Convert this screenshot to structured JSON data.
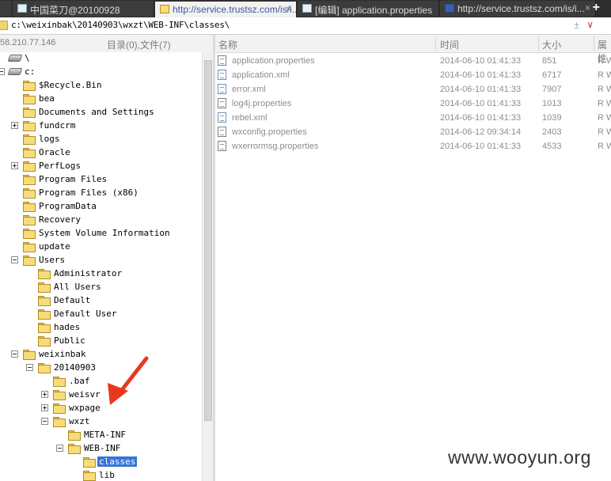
{
  "tabs": [
    {
      "label": "中国菜刀@20100928"
    },
    {
      "label": "http://service.trustsz.com/is/i..."
    },
    {
      "label": "[编辑] application.properties"
    },
    {
      "label": "http://service.trustsz.com/is/i..."
    }
  ],
  "tab_close_glyph": "×",
  "new_tab_glyph": "+",
  "path": {
    "value": "c:\\weixinbak\\20140903\\wxzt\\WEB-INF\\classes\\",
    "up_glyph": "±",
    "dropdown_glyph": "∨"
  },
  "tree_header": {
    "ip": "58.210.77.146",
    "count": "目录(0),文件(7)"
  },
  "tree": [
    {
      "label": "\\",
      "type": "drive"
    },
    {
      "label": "c:",
      "type": "drive"
    },
    {
      "label": "$Recycle.Bin"
    },
    {
      "label": "bea"
    },
    {
      "label": "Documents and Settings"
    },
    {
      "label": "fundcrm"
    },
    {
      "label": "logs"
    },
    {
      "label": "Oracle"
    },
    {
      "label": "PerfLogs"
    },
    {
      "label": "Program Files"
    },
    {
      "label": "Program Files (x86)"
    },
    {
      "label": "ProgramData"
    },
    {
      "label": "Recovery"
    },
    {
      "label": "System Volume Information"
    },
    {
      "label": "update"
    },
    {
      "label": "Users"
    },
    {
      "label": "Administrator"
    },
    {
      "label": "All Users"
    },
    {
      "label": "Default"
    },
    {
      "label": "Default User"
    },
    {
      "label": "hades"
    },
    {
      "label": "Public"
    },
    {
      "label": "weixinbak"
    },
    {
      "label": "20140903"
    },
    {
      "label": ".baf"
    },
    {
      "label": "weisvr"
    },
    {
      "label": "wxpage"
    },
    {
      "label": "wxzt"
    },
    {
      "label": "META-INF"
    },
    {
      "label": "WEB-INF"
    },
    {
      "label": "classes",
      "selected": true
    },
    {
      "label": "lib"
    }
  ],
  "list_header": {
    "name": "名称",
    "time": "时间",
    "size": "大小",
    "attr": "属性"
  },
  "files": [
    {
      "name": "application.properties",
      "time": "2014-06-10 01:41:33",
      "size": "851",
      "attr": "R W",
      "icon": "properties-file-icon"
    },
    {
      "name": "application.xml",
      "time": "2014-06-10 01:41:33",
      "size": "6717",
      "attr": "R W",
      "icon": "xml-file-icon"
    },
    {
      "name": "error.xml",
      "time": "2014-06-10 01:41:33",
      "size": "7907",
      "attr": "R W",
      "icon": "xml-file-icon"
    },
    {
      "name": "log4j.properties",
      "time": "2014-06-10 01:41:33",
      "size": "1013",
      "attr": "R W",
      "icon": "properties-file-icon"
    },
    {
      "name": "rebel.xml",
      "time": "2014-06-10 01:41:33",
      "size": "1039",
      "attr": "R W",
      "icon": "xml-file-icon"
    },
    {
      "name": "wxconfig.properties",
      "time": "2014-06-12 09:34:14",
      "size": "2403",
      "attr": "R W",
      "icon": "properties-file-icon"
    },
    {
      "name": "wxerrormsg.properties",
      "time": "2014-06-10 01:41:33",
      "size": "4533",
      "attr": "R W",
      "icon": "properties-file-icon"
    }
  ],
  "watermark": "www.wooyun.org",
  "colors": {
    "annotation_arrow": "#e8391e",
    "selection": "#3875d7"
  }
}
